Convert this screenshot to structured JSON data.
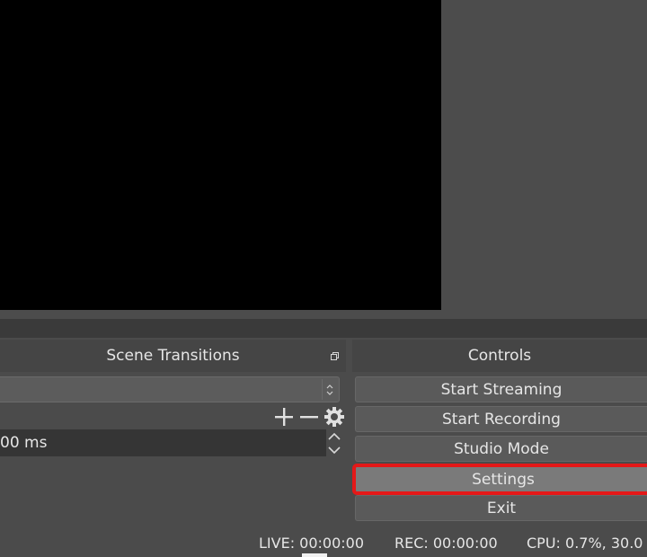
{
  "docks": {
    "transitions_title": "Scene Transitions",
    "controls_title": "Controls"
  },
  "transitions": {
    "duration_value": "00 ms"
  },
  "controls": {
    "start_streaming": "Start Streaming",
    "start_recording": "Start Recording",
    "studio_mode": "Studio Mode",
    "settings": "Settings",
    "exit": "Exit"
  },
  "status": {
    "live": "LIVE: 00:00:00",
    "rec": "REC: 00:00:00",
    "cpu": "CPU: 0.7%, 30.0"
  },
  "colors": {
    "highlight": "#e41818",
    "panel": "#4b4b4b",
    "preview": "#000000"
  },
  "icons": {
    "add": "plus-icon",
    "remove": "minus-icon",
    "properties": "gear-icon"
  }
}
